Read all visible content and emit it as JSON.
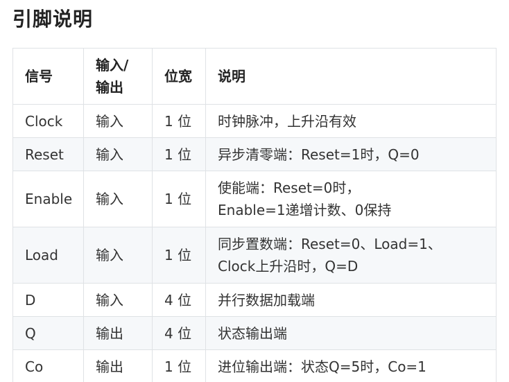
{
  "title": "引脚说明",
  "table": {
    "headers": {
      "signal": "信号",
      "direction": "输入/\n输出",
      "width": "位宽",
      "description": "说明"
    },
    "rows": [
      {
        "signal": "Clock",
        "direction": "输入",
        "width": "1 位",
        "description": "时钟脉冲，上升沿有效"
      },
      {
        "signal": "Reset",
        "direction": "输入",
        "width": "1 位",
        "description": "异步清零端：Reset=1时，Q=0"
      },
      {
        "signal": "Enable",
        "direction": "输入",
        "width": "1 位",
        "description": "使能端：Reset=0时，\nEnable=1递增计数、0保持"
      },
      {
        "signal": "Load",
        "direction": "输入",
        "width": "1 位",
        "description": "同步置数端：Reset=0、Load=1、\nClock上升沿时，Q=D"
      },
      {
        "signal": "D",
        "direction": "输入",
        "width": "4 位",
        "description": "并行数据加载端"
      },
      {
        "signal": "Q",
        "direction": "输出",
        "width": "4 位",
        "description": "状态输出端"
      },
      {
        "signal": "Co",
        "direction": "输出",
        "width": "1 位",
        "description": "进位输出端：状态Q=5时，Co=1"
      }
    ]
  }
}
